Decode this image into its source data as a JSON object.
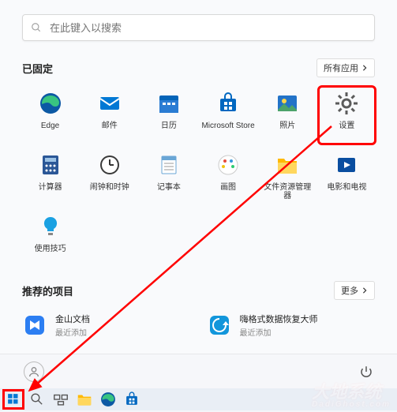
{
  "search": {
    "placeholder": "在此键入以搜索"
  },
  "pinned": {
    "title": "已固定",
    "all_btn": "所有应用",
    "items": [
      {
        "label": "Edge",
        "icon": "edge"
      },
      {
        "label": "邮件",
        "icon": "mail"
      },
      {
        "label": "日历",
        "icon": "calendar"
      },
      {
        "label": "Microsoft Store",
        "icon": "store"
      },
      {
        "label": "照片",
        "icon": "photos"
      },
      {
        "label": "设置",
        "icon": "settings",
        "highlight": true
      },
      {
        "label": "计算器",
        "icon": "calculator"
      },
      {
        "label": "闹钟和时钟",
        "icon": "clock"
      },
      {
        "label": "记事本",
        "icon": "notepad"
      },
      {
        "label": "画图",
        "icon": "paint"
      },
      {
        "label": "文件资源管理器",
        "icon": "explorer"
      },
      {
        "label": "电影和电视",
        "icon": "movies"
      },
      {
        "label": "使用技巧",
        "icon": "tips"
      }
    ]
  },
  "recommended": {
    "title": "推荐的项目",
    "more_btn": "更多",
    "items": [
      {
        "label": "金山文档",
        "sub": "最近添加",
        "icon": "wps"
      },
      {
        "label": "嗨格式数据恢复大师",
        "sub": "最近添加",
        "icon": "recover"
      }
    ]
  },
  "taskbar": {
    "items": [
      {
        "icon": "start",
        "highlight": true
      },
      {
        "icon": "search"
      },
      {
        "icon": "taskview"
      },
      {
        "icon": "explorer"
      },
      {
        "icon": "edge"
      },
      {
        "icon": "store"
      }
    ]
  },
  "watermark": {
    "main": "大地系统",
    "sub": "DadiGhost.com"
  }
}
